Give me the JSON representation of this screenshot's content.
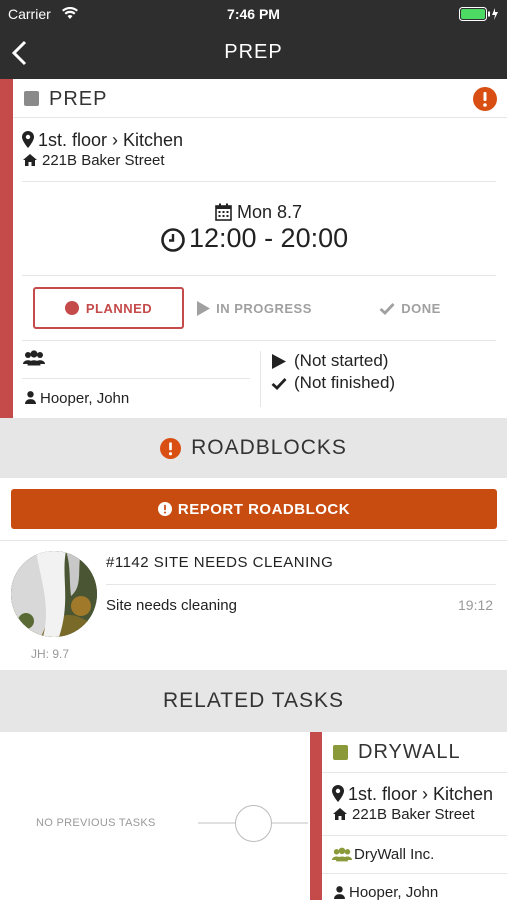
{
  "status_bar": {
    "carrier": "Carrier",
    "time": "7:46 PM"
  },
  "nav": {
    "title": "PREP"
  },
  "task": {
    "name": "PREP",
    "location": "1st. floor › Kitchen",
    "address": "221B Baker Street",
    "date": "Mon 8.7",
    "time_range": "12:00 - 20:00",
    "statuses": [
      "PLANNED",
      "IN PROGRESS",
      "DONE"
    ],
    "assignee": "Hooper, John",
    "started": "(Not started)",
    "finished": "(Not finished)",
    "accent_color": "#c54a4a",
    "alert_color": "#d94f13"
  },
  "roadblocks": {
    "header": "ROADBLOCKS",
    "report_button": "REPORT ROADBLOCK",
    "items": [
      {
        "title": "#1142 SITE NEEDS CLEANING",
        "text": "Site needs cleaning",
        "time": "19:12",
        "author": "JH: 9.7"
      }
    ]
  },
  "related": {
    "header": "RELATED TASKS",
    "no_previous": "NO PREVIOUS TASKS",
    "next_task": {
      "name": "DRYWALL",
      "location": "1st. floor › Kitchen",
      "address": "221B Baker Street",
      "company": "DryWall Inc.",
      "assignee": "Hooper, John",
      "accent_color": "#8a9a3b"
    }
  }
}
